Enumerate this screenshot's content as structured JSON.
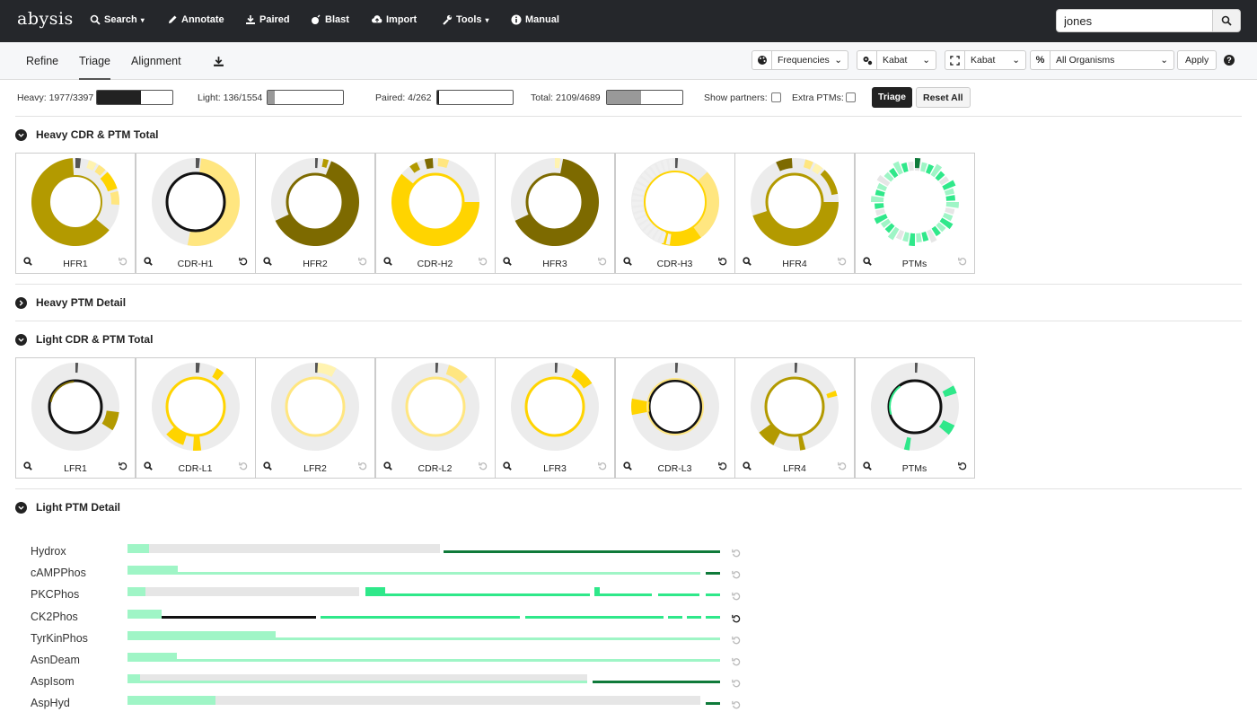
{
  "app": {
    "logo": "abysis"
  },
  "nav": {
    "items": [
      {
        "label": "Search",
        "icon": "search-icon",
        "caret": true
      },
      {
        "label": "Annotate",
        "icon": "pencil-icon"
      },
      {
        "label": "Paired",
        "icon": "download-icon"
      },
      {
        "label": "Blast",
        "icon": "bomb-icon"
      },
      {
        "label": "Import",
        "icon": "cloud-upload-icon"
      },
      {
        "label": "Tools",
        "icon": "wrench-icon",
        "caret": true
      },
      {
        "label": "Manual",
        "icon": "info-circle-icon"
      }
    ],
    "search_value": "jones"
  },
  "tabs": [
    {
      "label": "Refine"
    },
    {
      "label": "Triage",
      "active": true
    },
    {
      "label": "Alignment"
    }
  ],
  "controls": {
    "color_mode": "Frequencies",
    "numbering": "Kabat",
    "region": "Kabat",
    "organism": "All Organisms",
    "apply": "Apply"
  },
  "stats": {
    "heavy": "Heavy: 1977/3397",
    "heavy_frac": 0.58,
    "light": "Light: 136/1554",
    "light_frac": 0.09,
    "paired": "Paired: 4/262",
    "paired_frac": 0.02,
    "total": "Total: 2109/4689",
    "total_frac": 0.45,
    "show_partners": "Show partners:",
    "extra_ptms": "Extra PTMs:",
    "triage": "Triage",
    "reset_all": "Reset All"
  },
  "sections": {
    "heavy_cdr": "Heavy CDR & PTM Total",
    "heavy_ptm": "Heavy PTM Detail",
    "light_cdr": "Light CDR & PTM Total",
    "light_ptm": "Light PTM Detail"
  },
  "colors": {
    "olive_dark": "#7d6a00",
    "olive": "#b39a00",
    "gold": "#ffd400",
    "yellow_light": "#ffe680",
    "yellow_pale": "#fff3b0",
    "green": "#2fe88a",
    "green_light": "#9ff5c6",
    "green_dark": "#0f7a3a",
    "grey": "#ececec"
  },
  "heavy_charts": [
    {
      "label": "HFR1",
      "rings": [
        {
          "f": 0.62,
          "c": "olive"
        }
      ],
      "segs": [
        [
          0.03,
          "#555"
        ],
        [
          0.05,
          "yellow_pale"
        ],
        [
          0.06,
          "yellow_light"
        ],
        [
          0.07,
          "gold"
        ],
        [
          0.05,
          "yellow_light"
        ]
      ],
      "reset_active": false
    },
    {
      "label": "CDR-H1",
      "rings": [
        {
          "f": 0.42,
          "c": "yellow_light",
          "inner": "#111"
        }
      ],
      "reset_active": true
    },
    {
      "label": "HFR2",
      "rings": [
        {
          "f": 0.65,
          "c": "olive_dark"
        }
      ],
      "reset_active": false
    },
    {
      "label": "CDR-H2",
      "rings": [
        {
          "f": 0.7,
          "c": "gold"
        }
      ],
      "reset_active": false
    },
    {
      "label": "HFR3",
      "rings": [
        {
          "f": 0.6,
          "c": "olive_dark"
        }
      ],
      "reset_active": false
    },
    {
      "label": "CDR-H3",
      "rings": [
        {
          "f": 0.45,
          "c": "gold"
        }
      ],
      "reset_active": true
    },
    {
      "label": "HFR4",
      "rings": [
        {
          "f": 0.58,
          "c": "olive"
        }
      ],
      "reset_active": false
    },
    {
      "label": "PTMs",
      "rings": [
        {
          "f": 1.0,
          "c": "green"
        }
      ],
      "reset_active": false
    }
  ],
  "light_charts": [
    {
      "label": "LFR1",
      "reset_active": true
    },
    {
      "label": "CDR-L1",
      "reset_active": false
    },
    {
      "label": "LFR2",
      "reset_active": false
    },
    {
      "label": "CDR-L2",
      "reset_active": false
    },
    {
      "label": "LFR3",
      "reset_active": false
    },
    {
      "label": "CDR-L3",
      "reset_active": true
    },
    {
      "label": "LFR4",
      "reset_active": false
    },
    {
      "label": "PTMs",
      "reset_active": true
    }
  ],
  "light_ptm_rows": [
    {
      "label": "Hydrox",
      "reset_active": false
    },
    {
      "label": "cAMPPhos",
      "reset_active": false
    },
    {
      "label": "PKCPhos",
      "reset_active": false
    },
    {
      "label": "CK2Phos",
      "reset_active": true
    },
    {
      "label": "TyrKinPhos",
      "reset_active": false
    },
    {
      "label": "AsnDeam",
      "reset_active": false
    },
    {
      "label": "AspIsom",
      "reset_active": false
    },
    {
      "label": "AspHyd",
      "reset_active": false
    }
  ]
}
